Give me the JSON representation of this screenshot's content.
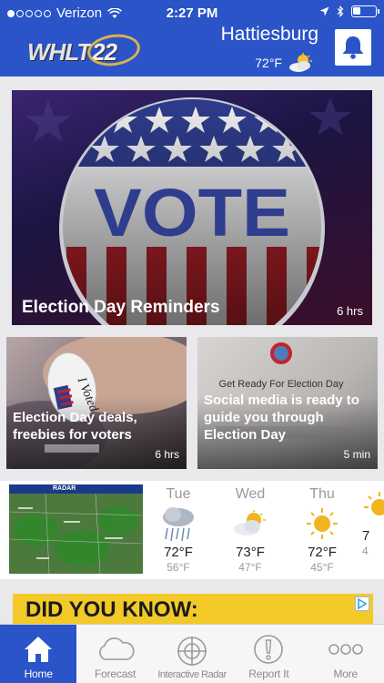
{
  "status_bar": {
    "carrier": "Verizon",
    "time": "2:27 PM",
    "battery_level": 0.35,
    "signal_bars_filled": 1
  },
  "header": {
    "logo_text": "WHLT",
    "logo_number": "22",
    "location": "Hattiesburg",
    "current_temp": "72°F",
    "brand_color": "#2a54c8"
  },
  "hero_story": {
    "title": "Election Day Reminders",
    "age": "6 hrs",
    "image_text": "VOTE"
  },
  "stories": [
    {
      "title": "Election Day deals, freebies for voters",
      "age": "6 hrs",
      "image_text": "I Voted"
    },
    {
      "title": "Social media is ready to guide you through Election Day",
      "age": "5 min",
      "image_text": "Get Ready For Election Day"
    }
  ],
  "weather": {
    "radar_label": "RADAR",
    "days": [
      {
        "name": "Tue",
        "hi": "72°F",
        "lo": "56°F",
        "icon": "rain-cloud-icon"
      },
      {
        "name": "Wed",
        "hi": "73°F",
        "lo": "47°F",
        "icon": "partly-sunny-icon"
      },
      {
        "name": "Thu",
        "hi": "72°F",
        "lo": "45°F",
        "icon": "sunny-icon"
      },
      {
        "name": "",
        "hi": "7",
        "lo": "4",
        "icon": "sunny-icon"
      }
    ]
  },
  "ad": {
    "text": "DID YOU KNOW:",
    "color": "#f3c928"
  },
  "tabs": [
    {
      "label": "Home",
      "icon": "home-icon",
      "active": true
    },
    {
      "label": "Forecast",
      "icon": "cloud-icon",
      "active": false
    },
    {
      "label": "Interactive Radar",
      "icon": "radar-crosshair-icon",
      "active": false
    },
    {
      "label": "Report It",
      "icon": "alert-icon",
      "active": false
    },
    {
      "label": "More",
      "icon": "more-dots-icon",
      "active": false
    }
  ]
}
